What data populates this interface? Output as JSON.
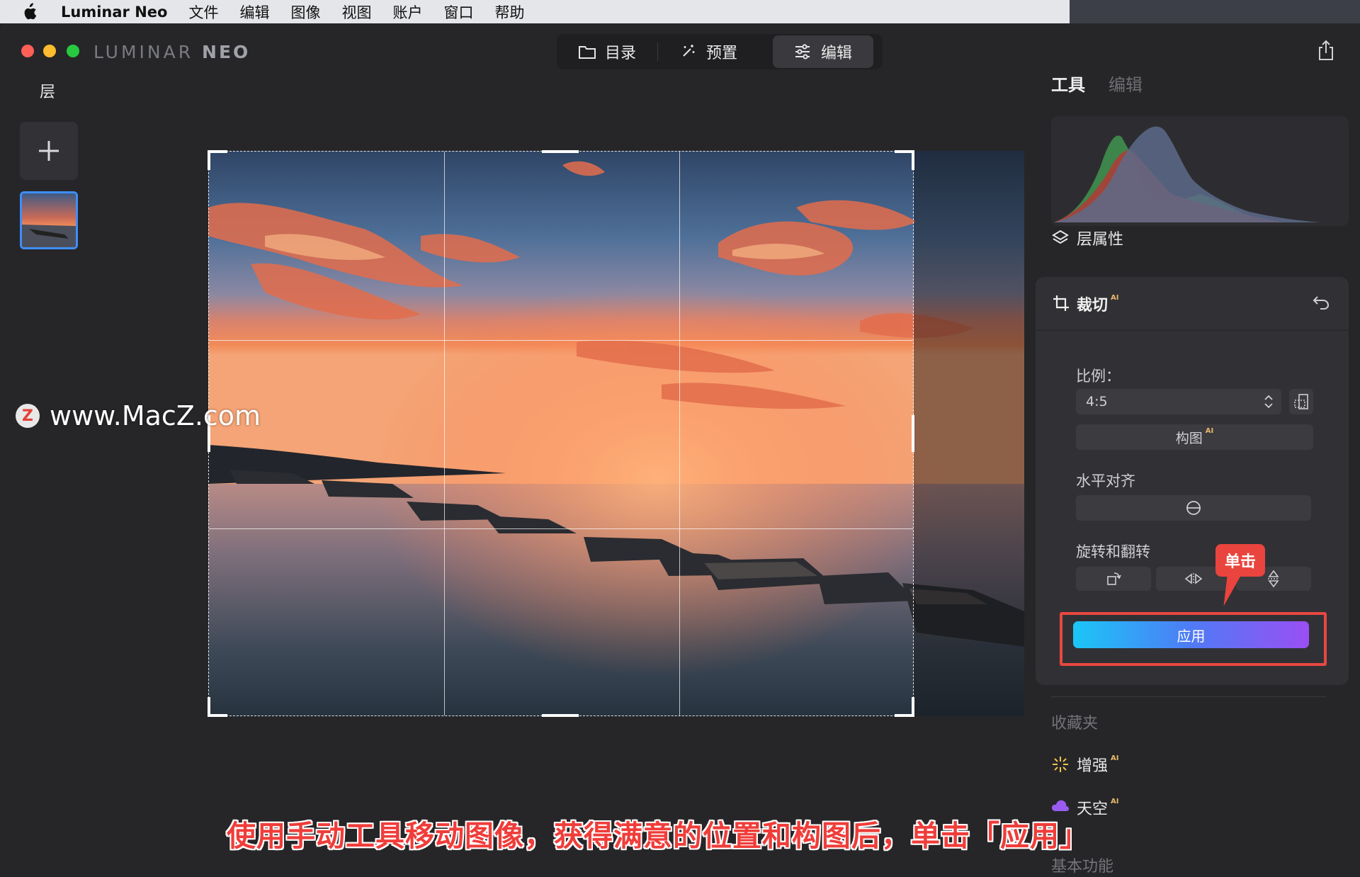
{
  "menubar": {
    "apple_icon": "apple-logo",
    "app_name": "Luminar Neo",
    "items": [
      "文件",
      "编辑",
      "图像",
      "视图",
      "账户",
      "窗口",
      "帮助"
    ]
  },
  "window": {
    "brand_left": "LUMINAR ",
    "brand_right": "NEO",
    "nav_tabs": [
      {
        "label": "目录",
        "icon": "folder-icon"
      },
      {
        "label": "预置",
        "icon": "magic-wand-icon"
      },
      {
        "label": "编辑",
        "icon": "sliders-icon",
        "active": true
      }
    ]
  },
  "layers_panel": {
    "title": "层"
  },
  "watermark": {
    "logo": "Z",
    "text": "www.MacZ.com"
  },
  "caption": "使用手动工具移动图像，获得满意的位置和构图后，单击「应用」",
  "right_panel": {
    "tabs": {
      "tools": "工具",
      "edit": "编辑"
    },
    "layer_properties": "层属性",
    "crop": {
      "title": "裁切",
      "ai_badge": "AI",
      "ratio_label": "比例：",
      "ratio_value": "4:5",
      "compose_label": "构图",
      "compose_ai": "AI",
      "level_label": "水平对齐",
      "rotate_label": "旋转和翻转",
      "apply_label": "应用"
    },
    "callout": "单击",
    "favorites_title": "收藏夹",
    "favorites": [
      {
        "label": "增强",
        "ai": "AI",
        "icon": "sparkle-icon"
      },
      {
        "label": "天空",
        "ai": "AI",
        "icon": "cloud-icon"
      }
    ],
    "basic_title": "基本功能"
  },
  "colors": {
    "accent_blue": "#3f8ef7",
    "apply_gradient_start": "#1bc6f7",
    "apply_gradient_end": "#9a4ff4",
    "annotation_red": "#e9443d"
  }
}
